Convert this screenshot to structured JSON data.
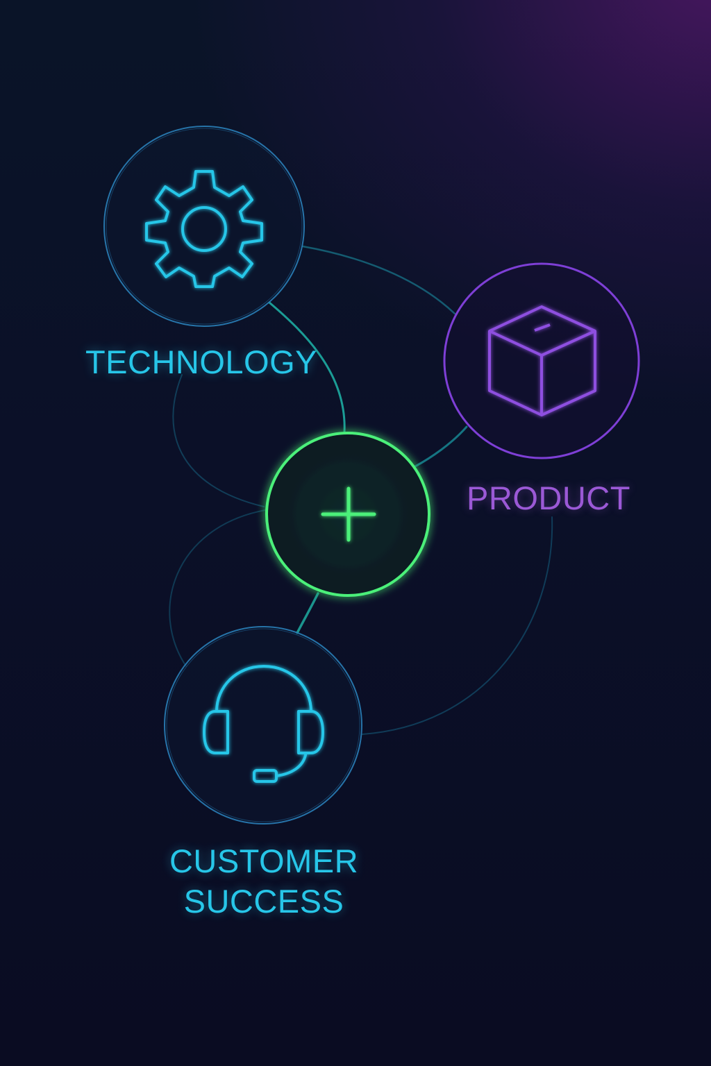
{
  "nodes": {
    "technology": {
      "label": "TECHNOLOGY",
      "icon": "gear-icon",
      "color": "#27c6e8"
    },
    "product": {
      "label": "PRODUCT",
      "icon": "box-icon",
      "color": "#9b59d6"
    },
    "customer_success": {
      "label_line1": "CUSTOMER",
      "label_line2": "SUCCESS",
      "icon": "headset-icon",
      "color": "#27c6e8"
    },
    "center": {
      "icon": "plus-icon",
      "color": "#4cf07a"
    }
  },
  "colors": {
    "background_top": "#0a1428",
    "background_bottom": "#0a0c22",
    "glow_purple": "#78188c",
    "connector": "#1fb5a8"
  }
}
